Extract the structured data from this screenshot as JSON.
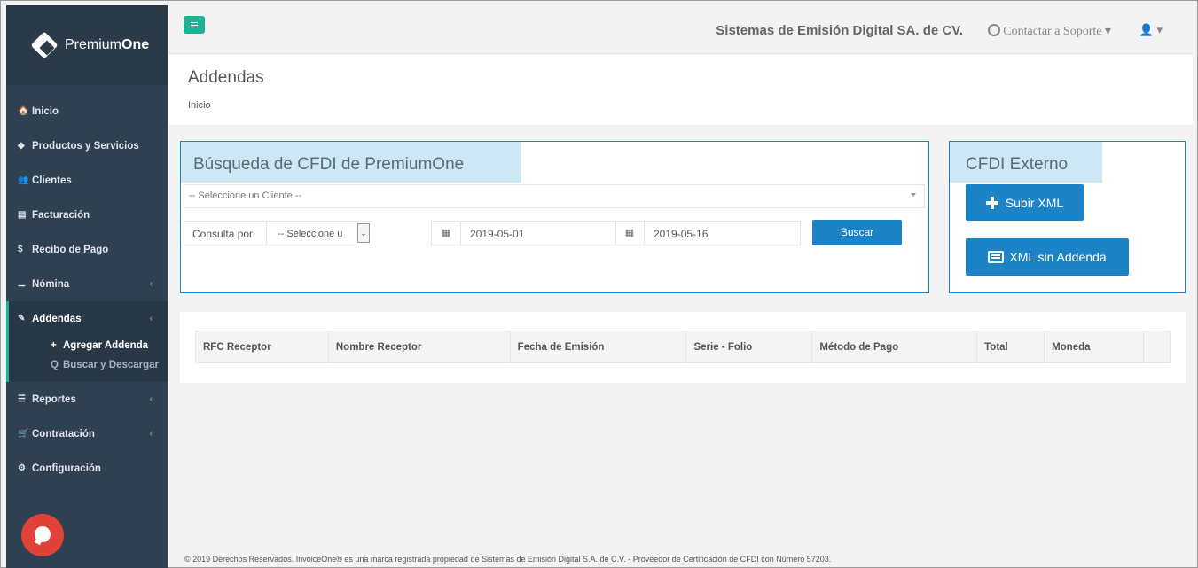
{
  "brand": {
    "name_light": "Premium",
    "name_bold": "One"
  },
  "sidebar": {
    "items": [
      {
        "label": "Inicio",
        "icon": "home-icon",
        "glyph": "🏠"
      },
      {
        "label": "Productos y Servicios",
        "icon": "tag-icon",
        "glyph": "◆"
      },
      {
        "label": "Clientes",
        "icon": "users-icon",
        "glyph": "👥"
      },
      {
        "label": "Facturación",
        "icon": "file-icon",
        "glyph": "▤"
      },
      {
        "label": "Recibo de Pago",
        "icon": "dollar-icon",
        "glyph": "$"
      },
      {
        "label": "Nómina",
        "icon": "sitemap-icon",
        "glyph": "⚊"
      }
    ],
    "active": {
      "label": "Addendas",
      "icon": "paperclip-icon",
      "glyph": "✎",
      "children": [
        {
          "label": "Agregar Addenda",
          "glyph": "+"
        },
        {
          "label": "Buscar y Descargar",
          "glyph": "🔍"
        }
      ]
    },
    "items_after": [
      {
        "label": "Reportes",
        "icon": "list-icon",
        "glyph": "☰"
      },
      {
        "label": "Contratación",
        "icon": "cart-icon",
        "glyph": "🛒"
      },
      {
        "label": "Configuración",
        "icon": "cogs-icon",
        "glyph": "⚙"
      }
    ]
  },
  "topbar": {
    "company": "Sistemas de Emisión Digital SA. de CV.",
    "support": "Contactar a Soporte",
    "user_icon": "user-icon"
  },
  "page": {
    "title": "Addendas",
    "breadcrumb": "Inicio"
  },
  "search": {
    "title": "Búsqueda de CFDI de PremiumOne",
    "client_placeholder": "-- Seleccione un Cliente --",
    "consulta_label": "Consulta por",
    "consulta_value": "-- Seleccione u",
    "date_from": "2019-05-01",
    "date_to": "2019-05-16",
    "button": "Buscar"
  },
  "external": {
    "title": "CFDI Externo",
    "upload_button": "Subir XML",
    "no_addenda_button": "XML sin Addenda"
  },
  "table": {
    "columns": [
      "RFC Receptor",
      "Nombre Receptor",
      "Fecha de Emisión",
      "Serie - Folio",
      "Método de Pago",
      "Total",
      "Moneda",
      ""
    ]
  },
  "footer": "© 2019 Derechos Reservados. InvoiceOne® es una marca registrada propiedad de Sistemas de Emisión Digital S.A. de C.V. - Proveedor de Certificación de CFDI con Número 57203.",
  "colors": {
    "sidebar": "#2f4050",
    "accent_green": "#1ab394",
    "primary_blue": "#1c84c6",
    "panel_title_bg": "#cde8f4",
    "chat": "#e0413a"
  }
}
